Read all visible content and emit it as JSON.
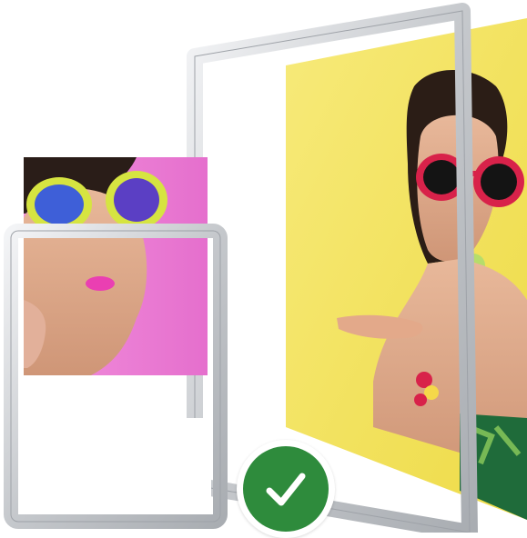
{
  "image": {
    "subject": "snap-frame-poster-display",
    "colors": {
      "frame_silver": "#c8cbcf",
      "frame_highlight": "#eef0f2",
      "yellow_poster": "#f2e25c",
      "pink_poster": "#ef7fd6",
      "badge_green": "#2e8b3c",
      "check_white": "#ffffff"
    },
    "badge": {
      "icon": "checkmark-icon"
    }
  }
}
